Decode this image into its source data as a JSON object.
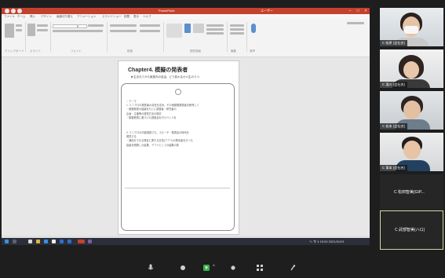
{
  "ppt": {
    "titlebar_title": "PowerPoint",
    "titlebar_user": "ユーザー",
    "tabs": [
      "ファイル",
      "ホーム",
      "挿入",
      "デザイン",
      "画面切り替え",
      "アニメーション",
      "スライドショー",
      "校閲",
      "表示",
      "ヘルプ"
    ],
    "ribbon_groups": [
      "クリップボード",
      "スライド",
      "フォント",
      "段落",
      "図形描画",
      "編集",
      "音声"
    ]
  },
  "slide": {
    "title": "Chapter4. 模擬の発表者",
    "subtitle": "■ 生まれてから家族内の自由、どう変わるか人生のうつ",
    "body_lines": [
      "・テーマ",
      "1. ミニアロの発表者の責任を定め、その他模擬発表者を教育して",
      "・模擬発表の議論をもとに調査者・研究者の",
      "  企画・主催等の運営方法の検討",
      "・模擬発表に基づいた調査会を行うべく人を",
      "",
      "2. ミニアロの内部調査でも、スピーチ・発表会の時代を",
      "   発見する",
      "・通信分でなる発言に関する意見(アプリ)の発信者を行った",
      "  議者を開発した結果、アプリとしての結果の表"
    ]
  },
  "taskbar": {
    "clock": "へ 令 4 15:00 2021/01/01"
  },
  "participants": [
    {
      "name": "C 松原 (会社名)"
    },
    {
      "name": "C 湯川 (会社名)"
    },
    {
      "name": "C 松本 (会社名)"
    },
    {
      "name": "C 東本 (会社名)"
    },
    {
      "name": "C 松田智美(GIP..."
    },
    {
      "name": "C 武部智美(ハロ)"
    }
  ],
  "zoom_toolbar": {
    "items": [
      "mic-icon",
      "chat-icon",
      "share-screen-icon",
      "reactions-icon",
      "apps-icon",
      "more-icon"
    ]
  },
  "colors": {
    "ppt_accent": "#c4412d",
    "active_speaker_border": "#d6d6a0",
    "share_green": "#36b24a"
  }
}
